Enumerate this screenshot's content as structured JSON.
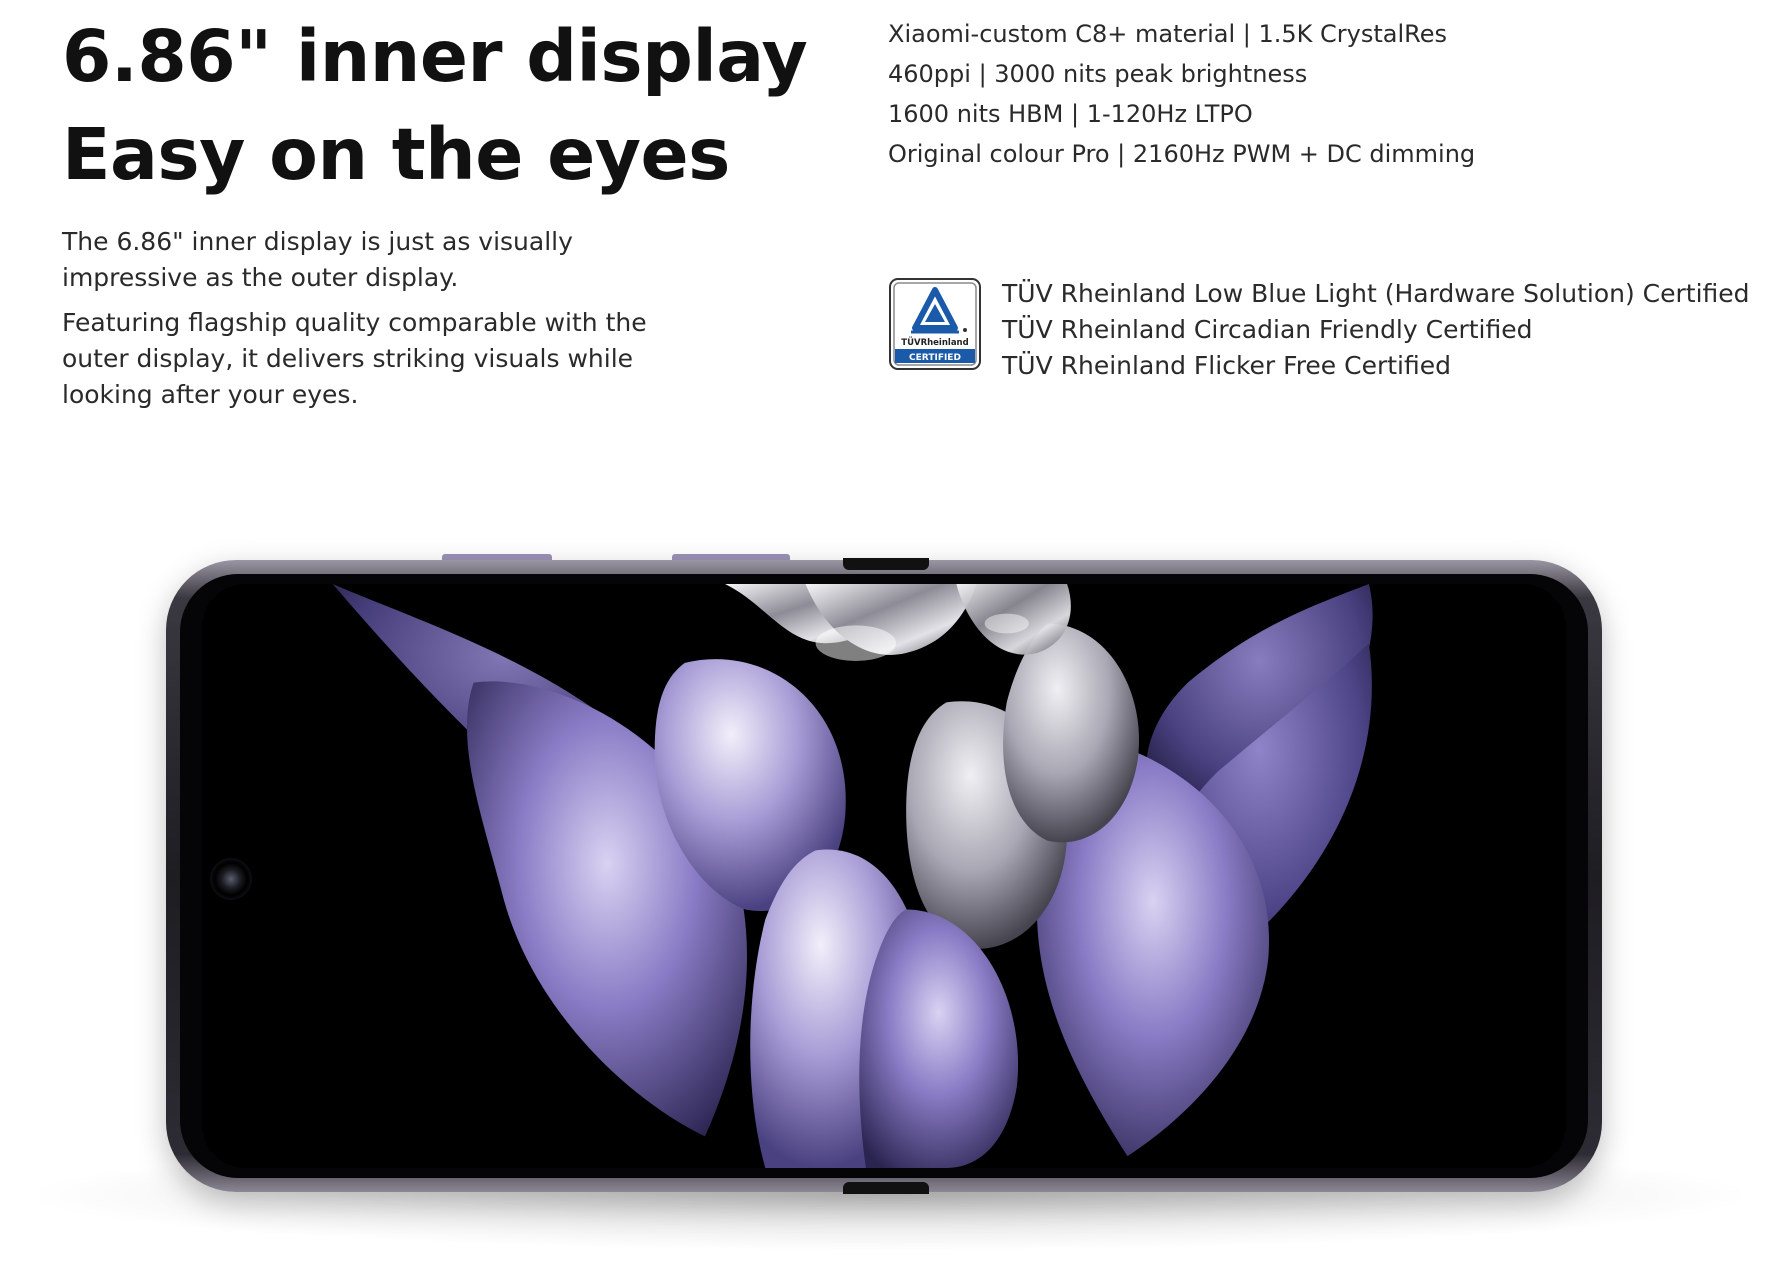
{
  "heading": {
    "line1": "6.86\" inner display",
    "line2": "Easy on the eyes"
  },
  "description": {
    "para1": "The 6.86\" inner display is just as visually impressive as the outer display.",
    "para2": "Featuring flagship quality comparable with the outer display, it delivers striking visuals while looking after your eyes."
  },
  "specs": [
    "Xiaomi-custom C8+ material | 1.5K CrystalRes",
    "460ppi | 3000 nits peak brightness",
    "1600 nits HBM | 1-120Hz LTPO",
    "Original colour Pro | 2160Hz PWM + DC dimming"
  ],
  "certifications": [
    "TÜV Rheinland Low Blue Light (Hardware Solution) Certified",
    "TÜV Rheinland Circadian Friendly Certified",
    "TÜV Rheinland Flicker Free Certified"
  ],
  "badge": {
    "brand": "TÜVRheinland",
    "label": "CERTIFIED",
    "icon": "tuv-rheinland-certified-icon"
  },
  "colors": {
    "text": "#111111",
    "body_text": "#2a2a2a",
    "petal_violet": "#7b6fb8",
    "badge_blue": "#1a5aa8"
  }
}
